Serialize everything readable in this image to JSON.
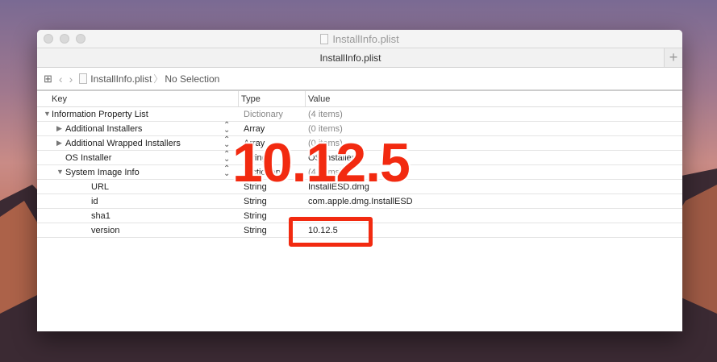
{
  "window": {
    "title": "InstallInfo.plist",
    "tab": "InstallInfo.plist"
  },
  "jumpbar": {
    "file": "InstallInfo.plist",
    "selection": "No Selection",
    "separator": "〉"
  },
  "columns": {
    "key": "Key",
    "type": "Type",
    "value": "Value"
  },
  "rows": [
    {
      "key": "Information Property List",
      "type": "Dictionary",
      "value": "(4 items)",
      "level": 0,
      "expander": "▼",
      "stepper": false,
      "dim": true
    },
    {
      "key": "Additional Installers",
      "type": "Array",
      "value": "(0 items)",
      "level": 1,
      "expander": "▶",
      "stepper": true,
      "dim": false
    },
    {
      "key": "Additional Wrapped Installers",
      "type": "Array",
      "value": "(0 items)",
      "level": 1,
      "expander": "▶",
      "stepper": true,
      "dim": false
    },
    {
      "key": "OS Installer",
      "type": "String",
      "value": "OS Installer",
      "level": 1,
      "expander": "",
      "stepper": true,
      "dim": false
    },
    {
      "key": "System Image Info",
      "type": "Dictionary",
      "value": "(4 items)",
      "level": 1,
      "expander": "▼",
      "stepper": true,
      "dim": false
    },
    {
      "key": "URL",
      "type": "String",
      "value": "InstallESD.dmg",
      "level": 2,
      "expander": "",
      "stepper": false,
      "dim": false
    },
    {
      "key": "id",
      "type": "String",
      "value": "com.apple.dmg.InstallESD",
      "level": 2,
      "expander": "",
      "stepper": false,
      "dim": false
    },
    {
      "key": "sha1",
      "type": "String",
      "value": "",
      "level": 2,
      "expander": "",
      "stepper": false,
      "dim": false
    },
    {
      "key": "version",
      "type": "String",
      "value": "10.12.5",
      "level": 2,
      "expander": "",
      "stepper": false,
      "dim": false
    }
  ],
  "overlay": {
    "label": "10.12.5",
    "color": "#f22a10"
  }
}
